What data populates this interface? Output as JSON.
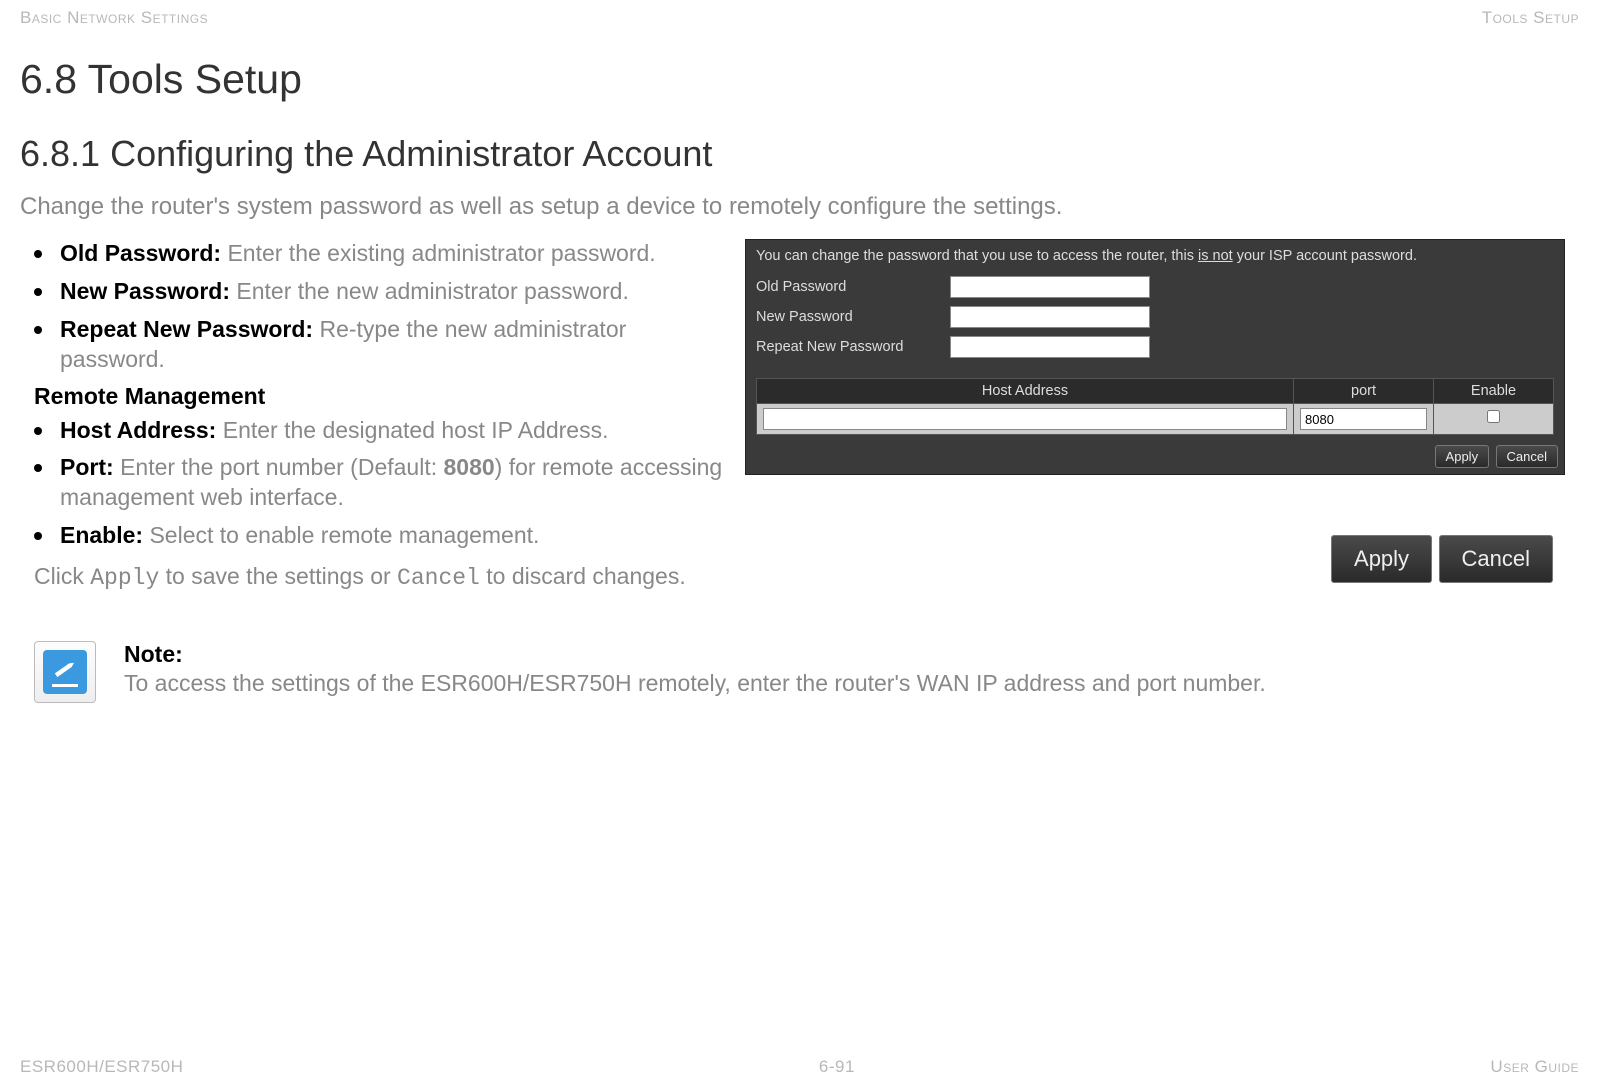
{
  "header": {
    "left": "Basic Network Settings",
    "right": "Tools Setup"
  },
  "h1": "6.8 Tools Setup",
  "h2": "6.8.1 Configuring the Administrator Account",
  "intro": "Change the router's system password as well as setup a device to remotely configure the settings.",
  "bullets1": [
    {
      "label": "Old Password:  ",
      "desc": "Enter the existing administrator password."
    },
    {
      "label": "New Password: ",
      "desc": "Enter the new administrator password."
    },
    {
      "label": "Repeat New Password: ",
      "desc": "Re-type the new administrator password."
    }
  ],
  "subheader": "Remote Management",
  "bullets2": [
    {
      "label": "Host Address: ",
      "desc": "Enter the designated host IP Address."
    },
    {
      "label": "Port: ",
      "desc1": "Enter the port number (Default: ",
      "bold": "8080",
      "desc2": ") for remote accessing management web interface."
    },
    {
      "label": "Enable: ",
      "desc": "Select to enable remote management."
    }
  ],
  "click_note": {
    "prefix": "Click ",
    "apply": "Apply",
    "mid": " to save the settings or ",
    "cancel": "Cancel",
    "suffix": " to discard changes."
  },
  "panel": {
    "top_note_pre": "You can change the password that you use to access the router, this ",
    "top_note_isnot": "is not",
    "top_note_post": " your ISP account password.",
    "rows": [
      {
        "label": "Old Password",
        "value": ""
      },
      {
        "label": "New Password",
        "value": ""
      },
      {
        "label": "Repeat New Password",
        "value": ""
      }
    ],
    "table_headers": {
      "host": "Host Address",
      "port": "port",
      "enable": "Enable"
    },
    "table_values": {
      "host": "",
      "port": "8080",
      "enable_checked": false
    },
    "buttons": {
      "apply": "Apply",
      "cancel": "Cancel"
    }
  },
  "big_buttons": {
    "apply": "Apply",
    "cancel": "Cancel"
  },
  "note": {
    "title": "Note:",
    "body": "To access the settings of the ESR600H/ESR750H remotely, enter the router's WAN IP address and port number."
  },
  "footer": {
    "left": "ESR600H/ESR750H",
    "center": "6-91",
    "right": "User Guide"
  }
}
